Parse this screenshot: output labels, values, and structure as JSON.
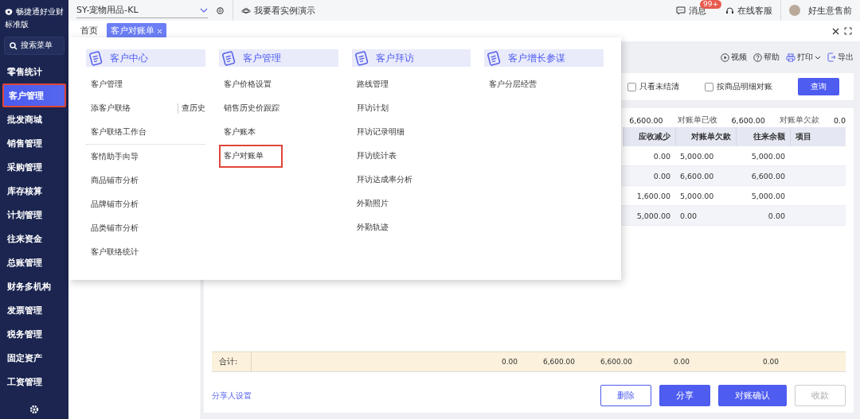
{
  "sidebar": {
    "brand": "畅捷通好业财",
    "edition": "标准版",
    "search": "搜索菜单",
    "items": [
      {
        "label": "零售统计",
        "selected": false
      },
      {
        "label": "客户管理",
        "selected": true
      },
      {
        "label": "批发商城",
        "selected": false
      },
      {
        "label": "销售管理",
        "selected": false
      },
      {
        "label": "采购管理",
        "selected": false
      },
      {
        "label": "库存核算",
        "selected": false
      },
      {
        "label": "计划管理",
        "selected": false
      },
      {
        "label": "往来资金",
        "selected": false
      },
      {
        "label": "总账管理",
        "selected": false
      },
      {
        "label": "财务多机构",
        "selected": false
      },
      {
        "label": "发票管理",
        "selected": false
      },
      {
        "label": "税务管理",
        "selected": false
      },
      {
        "label": "固定资产",
        "selected": false
      },
      {
        "label": "工资管理",
        "selected": false
      }
    ]
  },
  "topbar": {
    "account": "SY-宠物用品-KL",
    "demo": "我要看实例演示",
    "messages": "消息",
    "badge": "99+",
    "service": "在线客服",
    "user": "好生意售前"
  },
  "tabs": [
    {
      "label": "首页",
      "selected": false,
      "closable": false
    },
    {
      "label": "客户对账单",
      "selected": true,
      "closable": true
    }
  ],
  "toolbar": [
    {
      "kind": "video",
      "label": "视频"
    },
    {
      "kind": "help",
      "label": "帮助"
    },
    {
      "kind": "print",
      "label": "打印"
    },
    {
      "kind": "export",
      "label": "导出"
    }
  ],
  "filters": [
    {
      "label": "只看未结清",
      "checked": false
    },
    {
      "label": "按商品明细对账",
      "checked": false
    }
  ],
  "query_button": "查询",
  "summary": [
    {
      "kind": "value",
      "text": "6,600.00"
    },
    {
      "kind": "label",
      "text": "对账单已收"
    },
    {
      "kind": "value",
      "text": "6,600.00"
    },
    {
      "kind": "label",
      "text": "对账单欠款"
    },
    {
      "kind": "value",
      "text": "0.0"
    }
  ],
  "table": {
    "columns": [
      "应收减少",
      "对账单欠款",
      "往来余额",
      "项目"
    ],
    "rows": [
      [
        "0.00",
        "5,000.00",
        "5,000.00",
        ""
      ],
      [
        "0.00",
        "6,600.00",
        "6,600.00",
        ""
      ],
      [
        "1,600.00",
        "5,000.00",
        "5,000.00",
        ""
      ],
      [
        "5,000.00",
        "0.00",
        "0.00",
        ""
      ]
    ]
  },
  "totals": {
    "label": "合计:",
    "values": [
      "0.00",
      "6,600.00",
      "6,600.00",
      "0.00",
      "0.00"
    ]
  },
  "share_link": "分享人设置",
  "actions": [
    {
      "label": "删除",
      "kind": "outline"
    },
    {
      "label": "分享",
      "kind": "primary"
    },
    {
      "label": "对账确认",
      "kind": "primary"
    },
    {
      "label": "收款",
      "kind": "disabled"
    }
  ],
  "menu": {
    "columns": [
      {
        "title": "客户中心",
        "items": [
          {
            "label": "客户管理",
            "highlighted": false
          },
          {
            "label": "添客户联络",
            "extra": "查历史",
            "highlighted": false
          },
          {
            "label": "客户联络工作台",
            "highlighted": false,
            "divider_after": true
          },
          {
            "label": "客情助手向导",
            "highlighted": false
          },
          {
            "label": "商品铺市分析",
            "highlighted": false
          },
          {
            "label": "品牌铺市分析",
            "highlighted": false
          },
          {
            "label": "品类铺市分析",
            "highlighted": false
          },
          {
            "label": "客户联络统计",
            "highlighted": false
          }
        ]
      },
      {
        "title": "客户管理",
        "items": [
          {
            "label": "客户价格设置",
            "highlighted": false
          },
          {
            "label": "销售历史价跟踪",
            "highlighted": false
          },
          {
            "label": "客户账本",
            "highlighted": false
          },
          {
            "label": "客户对账单",
            "highlighted": true
          }
        ]
      },
      {
        "title": "客户拜访",
        "items": [
          {
            "label": "路线管理",
            "highlighted": false
          },
          {
            "label": "拜访计划",
            "highlighted": false
          },
          {
            "label": "拜访记录明细",
            "highlighted": false
          },
          {
            "label": "拜访统计表",
            "highlighted": false
          },
          {
            "label": "拜访达成率分析",
            "highlighted": false
          },
          {
            "label": "外勤照片",
            "highlighted": false
          },
          {
            "label": "外勤轨迹",
            "highlighted": false
          }
        ]
      },
      {
        "title": "客户增长参谋",
        "items": [
          {
            "label": "客户分层经营",
            "highlighted": false
          }
        ]
      }
    ]
  }
}
